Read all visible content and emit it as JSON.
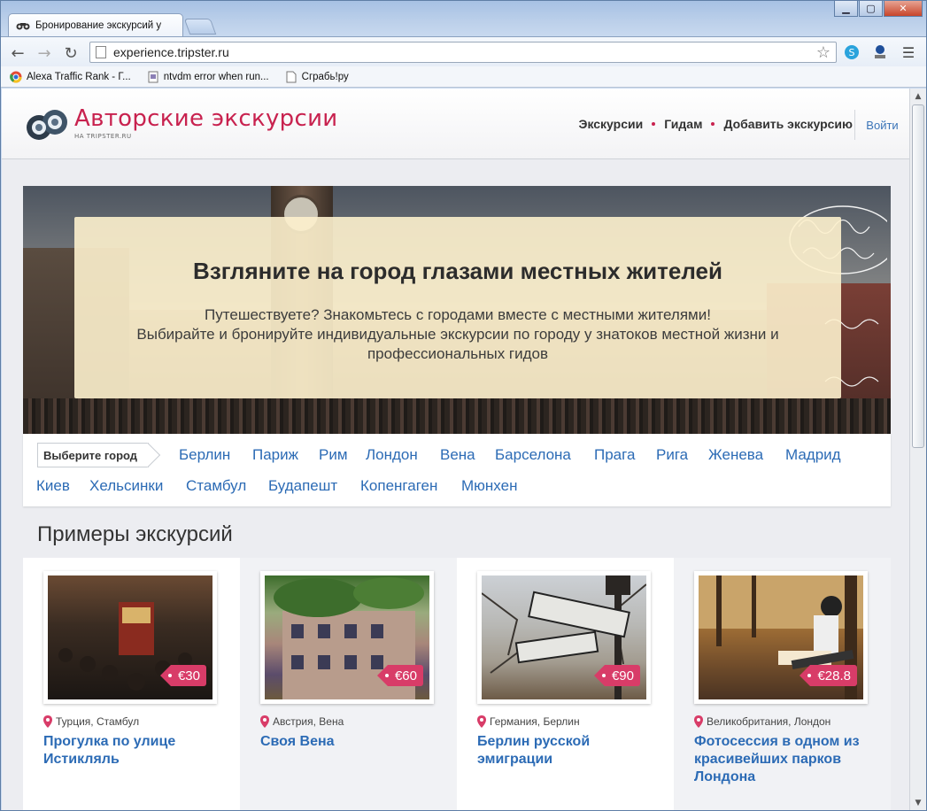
{
  "browser": {
    "tab_title": "Бронирование экскурсий у",
    "url": "experience.tripster.ru",
    "bookmarks": [
      {
        "label": "Alexa Traffic Rank - Г...",
        "icon": "chrome-icon"
      },
      {
        "label": "ntvdm error when run...",
        "icon": "page-icon"
      },
      {
        "label": "Сграбь!ру",
        "icon": "blank-page-icon"
      }
    ]
  },
  "site": {
    "logo_text": "Авторские экскурсии",
    "logo_sub": "НА TRIPSTER.RU",
    "nav": [
      "Экскурсии",
      "Гидам",
      "Добавить экскурсию"
    ],
    "login": "Войти",
    "accent_color": "#c8224f",
    "link_color": "#2c6bb5"
  },
  "hero": {
    "title": "Взгляните на город глазами местных жителей",
    "line1": "Путешествуете? Знакомьтесь с городами вместе с местными жителями!",
    "line2": "Выбирайте и бронируйте индивидуальные экскурсии по городу у знатоков местной жизни и профессиональных гидов"
  },
  "cities": {
    "pick_label": "Выберите город",
    "list": [
      "Берлин",
      "Париж",
      "Рим",
      "Лондон",
      "Вена",
      "Барселона",
      "Прага",
      "Рига",
      "Женева",
      "Мадрид",
      "Киев",
      "Хельсинки",
      "Стамбул",
      "Будапешт",
      "Копенгаген",
      "Мюнхен"
    ]
  },
  "examples": {
    "title": "Примеры экскурсий",
    "cards": [
      {
        "price": "€30",
        "location": "Турция, Стамбул",
        "title": "Прогулка по улице Истикляль"
      },
      {
        "price": "€60",
        "location": "Австрия, Вена",
        "title": "Своя Вена"
      },
      {
        "price": "€90",
        "location": "Германия, Берлин",
        "title": "Берлин русской эмиграции"
      },
      {
        "price": "€28.8",
        "location": "Великобритания, Лондон",
        "title": "Фотосессия в одном из красивейших парков Лондона"
      }
    ]
  }
}
